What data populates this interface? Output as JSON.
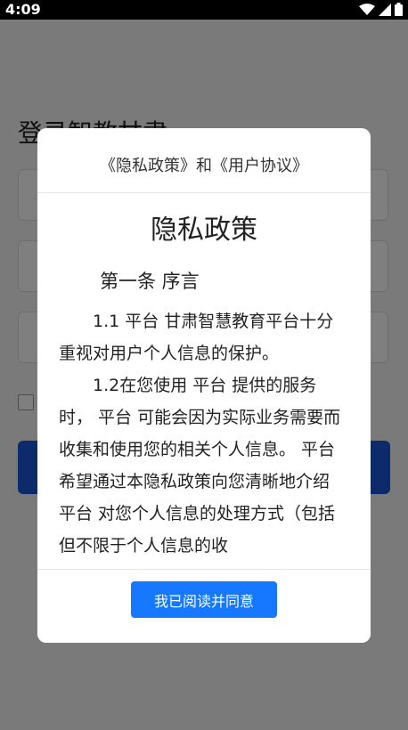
{
  "status_bar": {
    "time": "4:09"
  },
  "login": {
    "title": "登录智教甘肃"
  },
  "dialog": {
    "header_title": "《隐私政策》和《用户协议》",
    "doc_title": "隐私政策",
    "article_title": "第一条 序言",
    "para1": "1.1 平台 甘肃智慧教育平台十分重视对用户个人信息的保护。",
    "para2": "1.2在您使用 平台 提供的服务时， 平台 可能会因为实际业务需要而收集和使用您的相关个人信息。 平台 希望通过本隐私政策向您清晰地介绍 平台 对您个人信息的处理方式（包括但不限于个人信息的收",
    "agree_label": "我已阅读并同意"
  },
  "colors": {
    "primary": "#1677ff",
    "login_button": "#1a56d6"
  }
}
